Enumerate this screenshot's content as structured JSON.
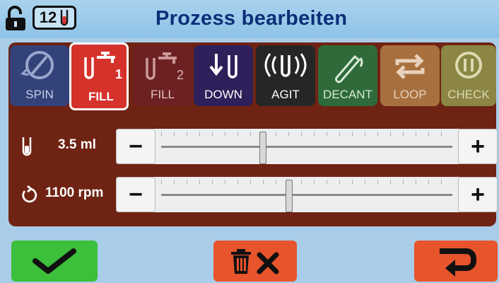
{
  "header": {
    "title": "Prozess bearbeiten",
    "tube_count": "12",
    "lock_icon": "unlocked-padlock-icon",
    "tube_icon": "test-tube-icon"
  },
  "tabs": [
    {
      "label": "SPIN",
      "icon": "spin-icon",
      "color": "#34427a",
      "active": false
    },
    {
      "label": "FILL",
      "badge": "1",
      "icon": "fill-1-icon",
      "color": "#d5322b",
      "active": true
    },
    {
      "label": "FILL",
      "badge": "2",
      "icon": "fill-2-icon",
      "color": "#6d2122",
      "active": false
    },
    {
      "label": "DOWN",
      "icon": "down-icon",
      "color": "#2f1f5a",
      "active": false
    },
    {
      "label": "AGIT",
      "icon": "agitate-icon",
      "color": "#262626",
      "active": false
    },
    {
      "label": "DECANT",
      "icon": "decant-icon",
      "color": "#2f6a3a",
      "active": false
    },
    {
      "label": "LOOP",
      "icon": "loop-icon",
      "color": "#a8703e",
      "active": false
    },
    {
      "label": "CHECK",
      "icon": "pause-check-icon",
      "color": "#8b8644",
      "active": false
    }
  ],
  "volume": {
    "value": "3.5 ml",
    "icon": "test-tube-icon",
    "level_fraction": 0.35,
    "minus": "−",
    "plus": "+"
  },
  "speed": {
    "value": "1100 rpm",
    "icon": "rotate-icon",
    "level_fraction": 0.44,
    "minus": "−",
    "plus": "+"
  },
  "footer": {
    "confirm_icon": "checkmark-icon",
    "delete_icon": "trash-x-icon",
    "back_icon": "return-arrow-icon",
    "confirm_color": "#3cbf3a",
    "delete_color": "#e8542c",
    "back_color": "#e8542c"
  }
}
